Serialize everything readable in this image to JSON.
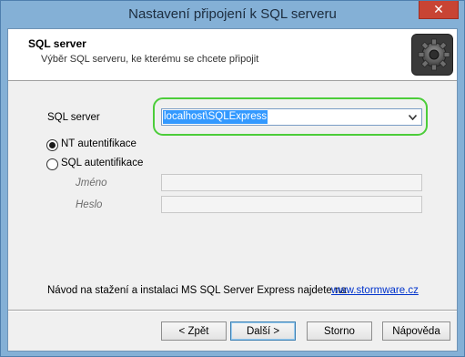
{
  "window": {
    "title": "Nastavení připojení k SQL serveru",
    "close_glyph": "✕"
  },
  "header": {
    "title": "SQL server",
    "subtitle": "Výběr SQL serveru, ke kterému se chcete připojit",
    "icon": "gear-icon"
  },
  "form": {
    "sql_server_label": "SQL server",
    "sql_server_value": "localhost\\SQLExpress",
    "auth_options": [
      {
        "label": "NT autentifikace",
        "selected": true
      },
      {
        "label": "SQL autentifikace",
        "selected": false
      }
    ],
    "username_label": "Jméno",
    "username_value": "",
    "password_label": "Heslo",
    "password_value": ""
  },
  "footer": {
    "text": "Návod na stažení a instalaci MS SQL Server Express najdete na",
    "link": "www.stormware.cz"
  },
  "buttons": {
    "back": "< Zpět",
    "next": "Další >",
    "cancel": "Storno",
    "help": "Nápověda"
  },
  "colors": {
    "titlebar": "#84b0d6",
    "highlight": "#4ccd3a",
    "selection": "#3399ff",
    "link": "#0033cc",
    "close": "#c84434"
  }
}
